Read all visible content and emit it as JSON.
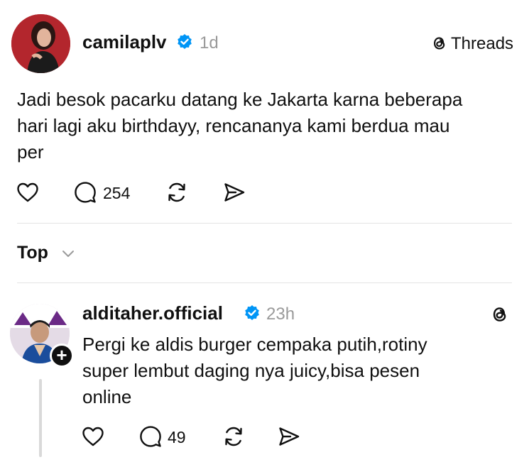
{
  "post": {
    "username": "camilaplv",
    "time": "1d",
    "source_label": "Threads",
    "text_line1": "Jadi besok pacarku datang ke Jakarta karna beberapa",
    "text_line2": "hari lagi aku birthdayy, rencananya kami berdua mau",
    "text_line3": "per",
    "reply_count": "254"
  },
  "sort": {
    "label": "Top"
  },
  "reply": {
    "username": "alditaher.official",
    "time": "23h",
    "text_line1": "Pergi ke aldis burger cempaka putih,rotiny",
    "text_line2": "super lembut daging nya juicy,bisa pesen",
    "text_line3": "online",
    "reply_count": "49"
  },
  "colors": {
    "verified": "#0095f6",
    "muted": "#9a9a9a"
  }
}
